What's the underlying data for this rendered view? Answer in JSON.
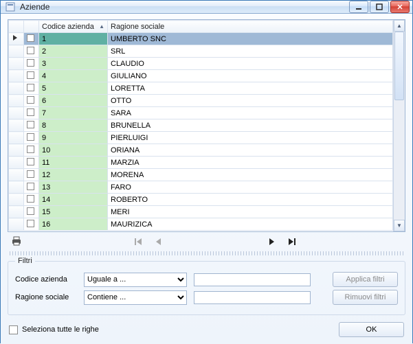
{
  "window": {
    "title": "Aziende"
  },
  "columns": {
    "code": "Codice azienda",
    "name": "Ragione sociale"
  },
  "rows": [
    {
      "id": "1",
      "name": "UMBERTO SNC",
      "selected": true
    },
    {
      "id": "2",
      "name": "SRL"
    },
    {
      "id": "3",
      "name": "CLAUDIO"
    },
    {
      "id": "4",
      "name": "GIULIANO"
    },
    {
      "id": "5",
      "name": "LORETTA"
    },
    {
      "id": "6",
      "name": "OTTO"
    },
    {
      "id": "7",
      "name": "SARA"
    },
    {
      "id": "8",
      "name": "BRUNELLA"
    },
    {
      "id": "9",
      "name": "PIERLUIGI"
    },
    {
      "id": "10",
      "name": "ORIANA"
    },
    {
      "id": "11",
      "name": "MARZIA"
    },
    {
      "id": "12",
      "name": "MORENA"
    },
    {
      "id": "13",
      "name": "FARO"
    },
    {
      "id": "14",
      "name": "ROBERTO"
    },
    {
      "id": "15",
      "name": "MERI"
    },
    {
      "id": "16",
      "name": "MAURIZICA"
    }
  ],
  "filters": {
    "legend": "Filtri",
    "label_code": "Codice azienda",
    "label_name": "Ragione sociale",
    "op_code": "Uguale a ...",
    "op_name": "Contiene ...",
    "val_code": "",
    "val_name": "",
    "apply": "Applica filtri",
    "remove": "Rimuovi filtri"
  },
  "select_all": "Seleziona tutte le righe",
  "ok": "OK"
}
